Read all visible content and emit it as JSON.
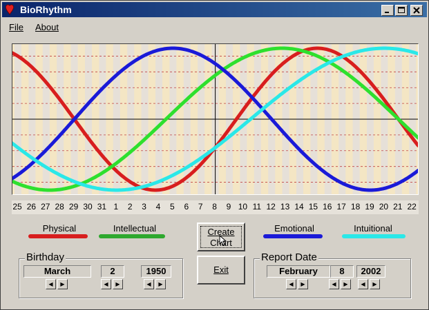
{
  "window": {
    "title": "BioRhythm"
  },
  "menu": {
    "file": "File",
    "about": "About"
  },
  "chart_data": {
    "type": "line",
    "x_labels": [
      "25",
      "26",
      "27",
      "28",
      "29",
      "30",
      "31",
      "1",
      "2",
      "3",
      "4",
      "5",
      "6",
      "7",
      "8",
      "9",
      "10",
      "11",
      "12",
      "13",
      "14",
      "15",
      "16",
      "17",
      "18",
      "19",
      "20",
      "21",
      "22"
    ],
    "current_day_label": "8",
    "series": [
      {
        "name": "Physical",
        "color": "#d81e1e",
        "period": 23,
        "phase": 7.5
      },
      {
        "name": "Intellectual",
        "color": "#2ee02e",
        "period": 33,
        "phase": 22.5
      },
      {
        "name": "Emotional",
        "color": "#1a1ad8",
        "period": 28,
        "phase": 24
      },
      {
        "name": "Intuitional",
        "color": "#2ae8e8",
        "period": 38,
        "phase": 21.5
      }
    ],
    "ylim": [
      -1,
      1
    ],
    "grid": true
  },
  "legend": {
    "physical": "Physical",
    "intellectual": "Intellectual",
    "emotional": "Emotional",
    "intuitional": "Intuitional"
  },
  "colors": {
    "physical": "#d81e1e",
    "intellectual": "#2ea82e",
    "emotional": "#1a1ad8",
    "intuitional": "#2ae8e8"
  },
  "buttons": {
    "create_line1": "Create",
    "create_line2": "Chart",
    "exit": "Exit"
  },
  "birthday": {
    "title": "Birthday",
    "month": "March",
    "day": "2",
    "year": "1950"
  },
  "report": {
    "title": "Report Date",
    "month": "February",
    "day": "8",
    "year": "2002"
  }
}
